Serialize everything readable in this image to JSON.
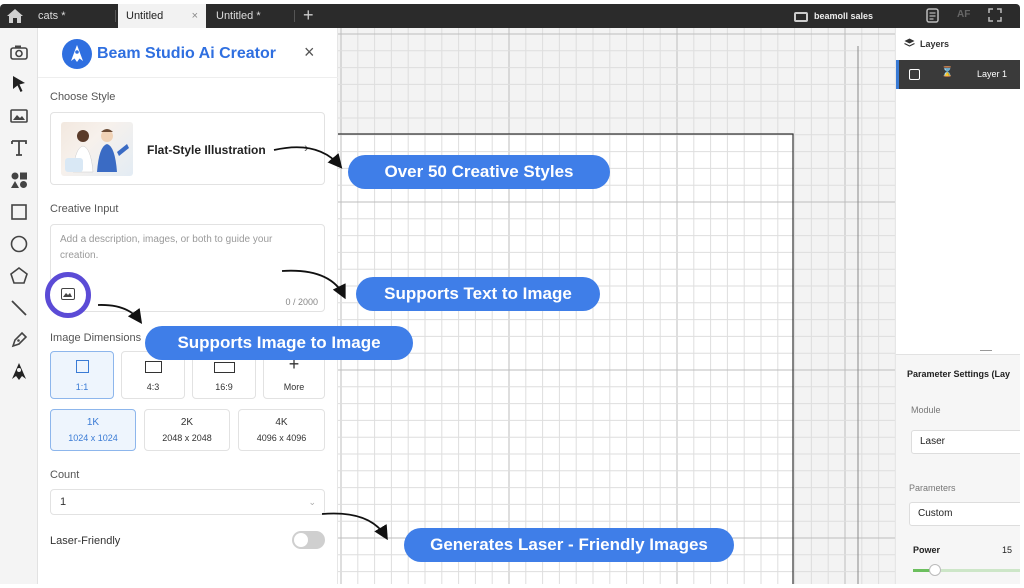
{
  "tabs": [
    {
      "label": "cats *"
    },
    {
      "label": "Untitled"
    },
    {
      "label": "Untitled *"
    }
  ],
  "topbar": {
    "user": "beamoll sales",
    "af_label": "AF"
  },
  "panel": {
    "title": "Beam Studio Ai Creator",
    "choose_style_label": "Choose Style",
    "style_name": "Flat-Style Illustration",
    "creative_input_label": "Creative Input",
    "input_placeholder": "Add a description, images, or both to guide your creation.",
    "char_count": "0 / 2000",
    "image_dimensions_label": "Image Dimensions",
    "ratios": [
      {
        "label": "1:1",
        "selected": true
      },
      {
        "label": "4:3"
      },
      {
        "label": "16:9"
      },
      {
        "label": "More"
      }
    ],
    "resolutions": [
      {
        "label": "1K",
        "size": "1024 x 1024",
        "selected": true
      },
      {
        "label": "2K",
        "size": "2048 x 2048"
      },
      {
        "label": "4K",
        "size": "4096 x 4096"
      }
    ],
    "count_label": "Count",
    "count_value": "1",
    "laser_friendly_label": "Laser-Friendly",
    "laser_friendly_on": false
  },
  "right": {
    "layers_title": "Layers",
    "layer_name": "Layer 1",
    "param_title": "Parameter Settings (Lay",
    "module_label": "Module",
    "module_value": "Laser",
    "parameters_label": "Parameters",
    "parameters_value": "Custom",
    "power_label": "Power",
    "power_value": "15"
  },
  "callouts": {
    "styles": "Over 50 Creative Styles",
    "text_to_image": "Supports Text to Image",
    "image_to_image": "Supports Image to Image",
    "laser_friendly": "Generates Laser - Friendly Images"
  },
  "colors": {
    "accent": "#3f7ee8",
    "title_blue": "#2f6fe0",
    "ring": "#5b4bd6"
  }
}
